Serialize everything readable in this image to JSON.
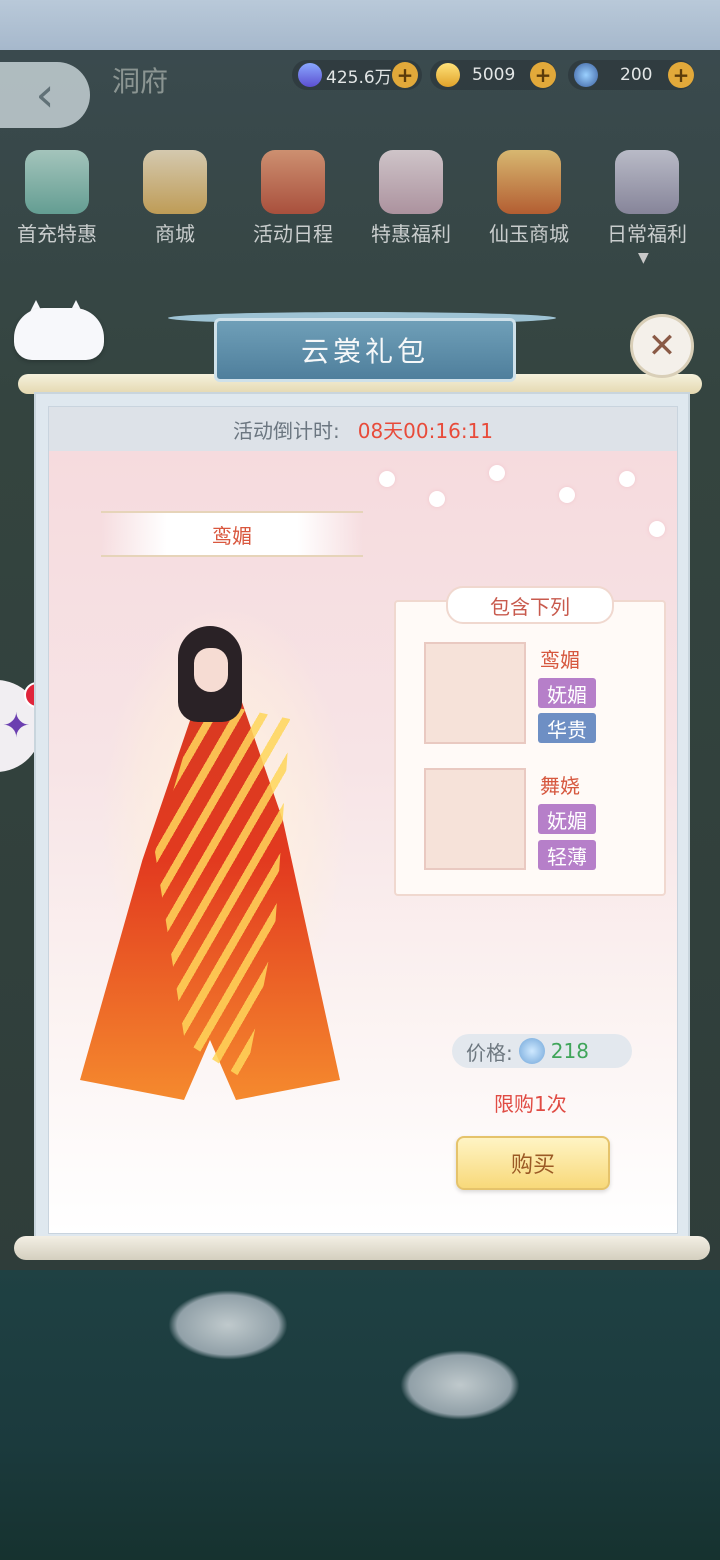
{
  "header": {
    "title": "洞府",
    "currencies": [
      {
        "icon": "crystal-icon",
        "value": "425.6万"
      },
      {
        "icon": "gold-ingot-icon",
        "value": "5009"
      },
      {
        "icon": "jade-orb-icon",
        "value": "200"
      }
    ]
  },
  "menu": [
    {
      "label": "首充特惠",
      "icon": "first-recharge-icon"
    },
    {
      "label": "商城",
      "icon": "shop-icon"
    },
    {
      "label": "活动日程",
      "icon": "event-schedule-icon"
    },
    {
      "label": "特惠福利",
      "icon": "special-benefit-icon"
    },
    {
      "label": "仙玉商城",
      "icon": "jade-shop-icon"
    },
    {
      "label": "日常福利",
      "icon": "daily-benefit-icon"
    }
  ],
  "modal": {
    "title": "云裳礼包",
    "countdown_label": "活动倒计时:",
    "countdown_value": "08天00:16:11",
    "outfit_name": "鸾媚",
    "contains_title": "包含下列",
    "items": [
      {
        "name": "鸾媚",
        "tags": [
          "妩媚",
          "华贵"
        ],
        "tag_colors": [
          "#b67fc9",
          "#6e8fc4"
        ]
      },
      {
        "name": "舞娆",
        "tags": [
          "妩媚",
          "轻薄"
        ],
        "tag_colors": [
          "#b67fc9",
          "#b67fc9"
        ]
      }
    ],
    "price_label": "价格:",
    "price_value": "218",
    "limit_text": "限购1次",
    "buy_label": "购买"
  }
}
